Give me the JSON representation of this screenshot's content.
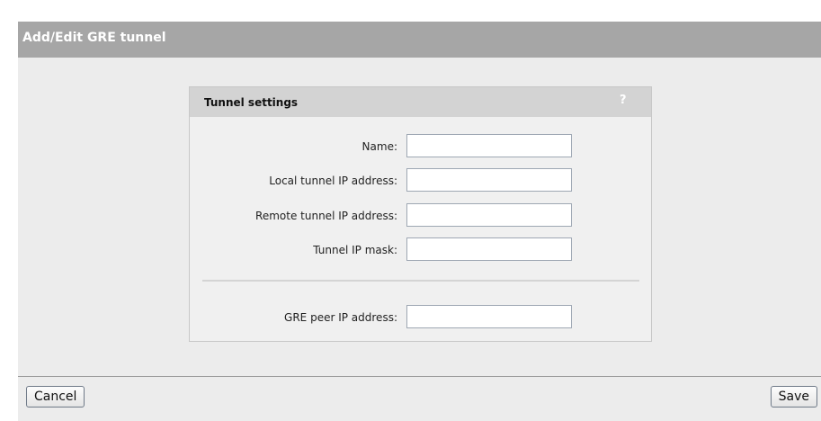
{
  "page": {
    "title": "Add/Edit GRE tunnel"
  },
  "panel": {
    "title": "Tunnel settings",
    "help_glyph": "?",
    "fields": [
      {
        "label": "Name:",
        "value": ""
      },
      {
        "label": "Local tunnel IP address:",
        "value": ""
      },
      {
        "label": "Remote tunnel IP address:",
        "value": ""
      },
      {
        "label": "Tunnel IP mask:",
        "value": ""
      }
    ],
    "peer_field": {
      "label": "GRE peer IP address:",
      "value": ""
    }
  },
  "footer": {
    "cancel_label": "Cancel",
    "save_label": "Save"
  },
  "colors": {
    "title_bar": "#a6a6a6",
    "panel_header": "#d3d3d3",
    "background": "#ececec"
  }
}
